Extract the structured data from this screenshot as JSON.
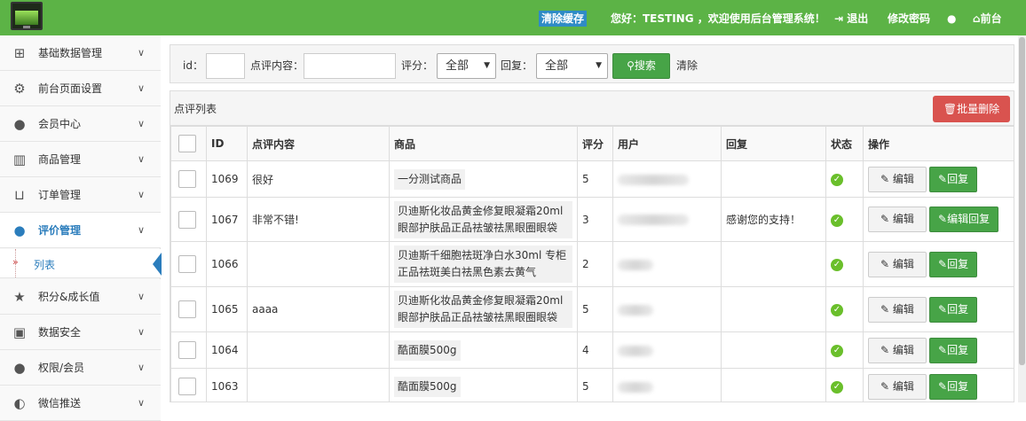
{
  "topbar": {
    "clear_cache": "清除缓存",
    "greeting": "您好：TESTING ，欢迎使用后台管理系统！",
    "logout": "退出",
    "change_password": "修改密码",
    "frontend": "前台",
    "brand_color": "#5cb346"
  },
  "sidebar": {
    "items": [
      {
        "label": "基础数据管理",
        "icon": "sitemap-icon"
      },
      {
        "label": "前台页面设置",
        "icon": "gears-icon"
      },
      {
        "label": "会员中心",
        "icon": "user-icon"
      },
      {
        "label": "商品管理",
        "icon": "barcode-icon"
      },
      {
        "label": "订单管理",
        "icon": "cart-icon"
      },
      {
        "label": "评价管理",
        "icon": "comments-icon"
      },
      {
        "label": "积分&成长值",
        "icon": "star-icon"
      },
      {
        "label": "数据安全",
        "icon": "lock-icon"
      },
      {
        "label": "权限/会员",
        "icon": "user-icon"
      },
      {
        "label": "微信推送",
        "icon": "wechat-icon"
      }
    ],
    "sub_item": "列表",
    "active_color": "#2b7dbc"
  },
  "filter": {
    "id_label": "id：",
    "content_label": "点评内容：",
    "rating_label": "评分：",
    "rating_value": "全部",
    "reply_label": "回复：",
    "reply_value": "全部",
    "search_button": "搜索",
    "clear_link": "清除"
  },
  "panel": {
    "title": "点评列表",
    "batch_delete": "批量删除"
  },
  "table": {
    "headers": [
      "",
      "ID",
      "点评内容",
      "商品",
      "评分",
      "用户",
      "回复",
      "状态",
      "操作"
    ],
    "rows": [
      {
        "id": "1069",
        "content": "很好",
        "product": "一分测试商品",
        "rating": "5",
        "reply": "",
        "edit": "编辑",
        "action": "回复"
      },
      {
        "id": "1067",
        "content": "非常不错!",
        "product": "贝迪斯化妆品黄金修复眼凝霜20ml眼部护肤品正品祛皱祛黑眼圈眼袋",
        "rating": "3",
        "reply": "感谢您的支持！",
        "edit": "编辑",
        "action": "编辑回复"
      },
      {
        "id": "1066",
        "content": "",
        "product": "贝迪斯千细胞祛斑净白水30ml 专柜正品祛斑美白祛黑色素去黄气",
        "rating": "2",
        "reply": "",
        "edit": "编辑",
        "action": "回复"
      },
      {
        "id": "1065",
        "content": "aaaa",
        "product": "贝迪斯化妆品黄金修复眼凝霜20ml眼部护肤品正品祛皱祛黑眼圈眼袋",
        "rating": "5",
        "reply": "",
        "edit": "编辑",
        "action": "回复"
      },
      {
        "id": "1064",
        "content": "",
        "product": "酷面膜500g",
        "rating": "4",
        "reply": "",
        "edit": "编辑",
        "action": "回复"
      },
      {
        "id": "1063",
        "content": "",
        "product": "酷面膜500g",
        "rating": "5",
        "reply": "",
        "edit": "编辑",
        "action": "回复"
      }
    ]
  }
}
